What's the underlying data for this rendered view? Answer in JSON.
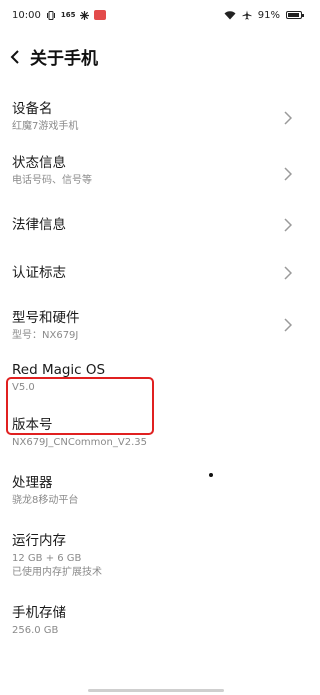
{
  "status_bar": {
    "time": "10:00",
    "network_speed": "165",
    "battery_percent": "91%"
  },
  "header": {
    "title": "关于手机"
  },
  "items": [
    {
      "title": "设备名",
      "subtitle": "红魔7游戏手机",
      "chevron": true
    },
    {
      "title": "状态信息",
      "subtitle": "电话号码、信号等",
      "chevron": true
    },
    {
      "title": "法律信息",
      "subtitle": "",
      "chevron": true
    },
    {
      "title": "认证标志",
      "subtitle": "",
      "chevron": true
    },
    {
      "title": "型号和硬件",
      "subtitle": "型号：NX679J",
      "chevron": true
    },
    {
      "title": "Red Magic OS",
      "subtitle": "V5.0",
      "chevron": false
    },
    {
      "title": "版本号",
      "subtitle": "NX679J_CNCommon_V2.35",
      "chevron": false
    },
    {
      "title": "处理器",
      "subtitle": "骁龙8移动平台",
      "chevron": false
    },
    {
      "title": "运行内存",
      "subtitle": "12 GB + 6 GB",
      "subtitle2": "已使用内存扩展技术",
      "chevron": false
    },
    {
      "title": "手机存储",
      "subtitle": "256.0 GB",
      "chevron": false
    }
  ],
  "colors": {
    "highlight": "#e02020"
  }
}
